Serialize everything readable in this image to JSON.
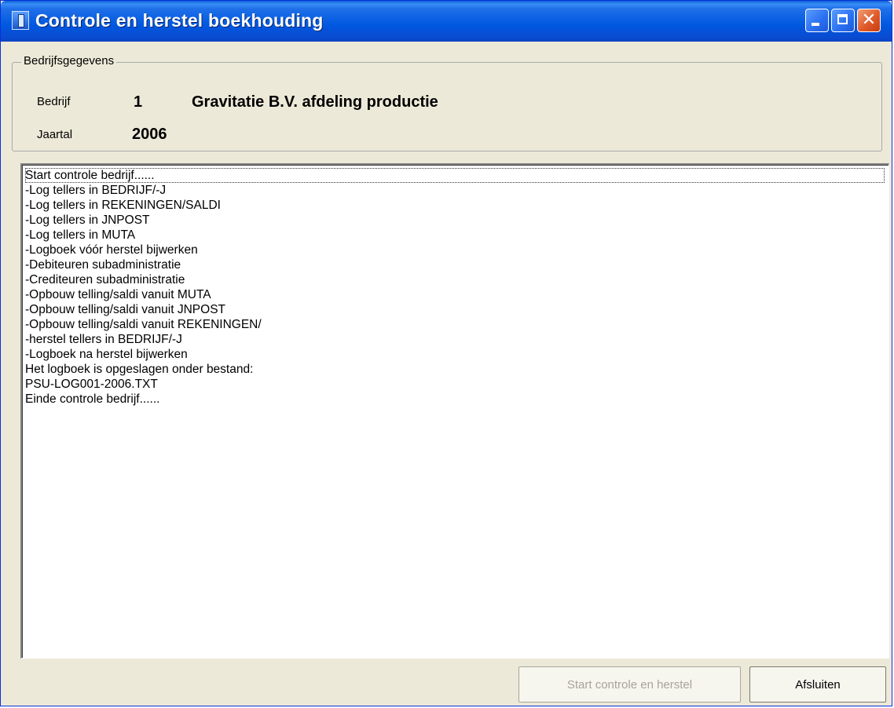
{
  "window": {
    "title": "Controle en herstel boekhouding"
  },
  "company_info": {
    "group_title": "Bedrijfsgegevens",
    "company_label": "Bedrijf",
    "company_number": "1",
    "company_name": "Gravitatie B.V. afdeling productie",
    "year_label": "Jaartal",
    "year_value": "2006"
  },
  "log": {
    "lines": [
      "Start controle bedrijf......",
      "-Log tellers in BEDRIJF/-J",
      "-Log tellers in REKENINGEN/SALDI",
      "-Log tellers in JNPOST",
      "-Log tellers in MUTA",
      "-Logboek vóór herstel bijwerken",
      "-Debiteuren subadministratie",
      "-Crediteuren subadministratie",
      "-Opbouw telling/saldi vanuit MUTA",
      "-Opbouw telling/saldi vanuit JNPOST",
      "-Opbouw telling/saldi vanuit REKENINGEN/",
      "-herstel tellers in BEDRIJF/-J",
      "-Logboek na herstel bijwerken",
      "Het logboek is opgeslagen onder bestand:",
      "PSU-LOG001-2006.TXT",
      "Einde controle bedrijf......"
    ]
  },
  "buttons": {
    "start_label": "Start controle en herstel",
    "close_label": "Afsluiten"
  },
  "icons": {
    "app": "app-icon",
    "minimize": "minimize-icon",
    "maximize": "maximize-icon",
    "close": "close-icon"
  }
}
